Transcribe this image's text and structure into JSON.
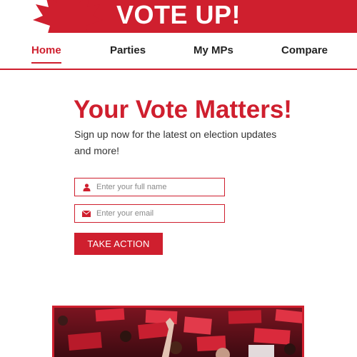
{
  "header": {
    "title": "VOTE UP!",
    "logo_icon": "maple-leaf-icon",
    "brand_color": "#cf1f2e"
  },
  "nav": {
    "items": [
      {
        "label": "Home",
        "active": true
      },
      {
        "label": "Parties",
        "active": false
      },
      {
        "label": "My MPs",
        "active": false
      },
      {
        "label": "Compare",
        "active": false
      }
    ]
  },
  "hero": {
    "headline": "Your Vote Matters!",
    "subtext": "Sign up now for the latest on election updates and more!"
  },
  "form": {
    "name_placeholder": "Enter your full name",
    "name_icon": "user-icon",
    "email_placeholder": "Enter your email",
    "email_icon": "envelope-icon",
    "submit_label": "TAKE ACTION"
  },
  "photo": {
    "subject": "rally-crowd-photo"
  }
}
